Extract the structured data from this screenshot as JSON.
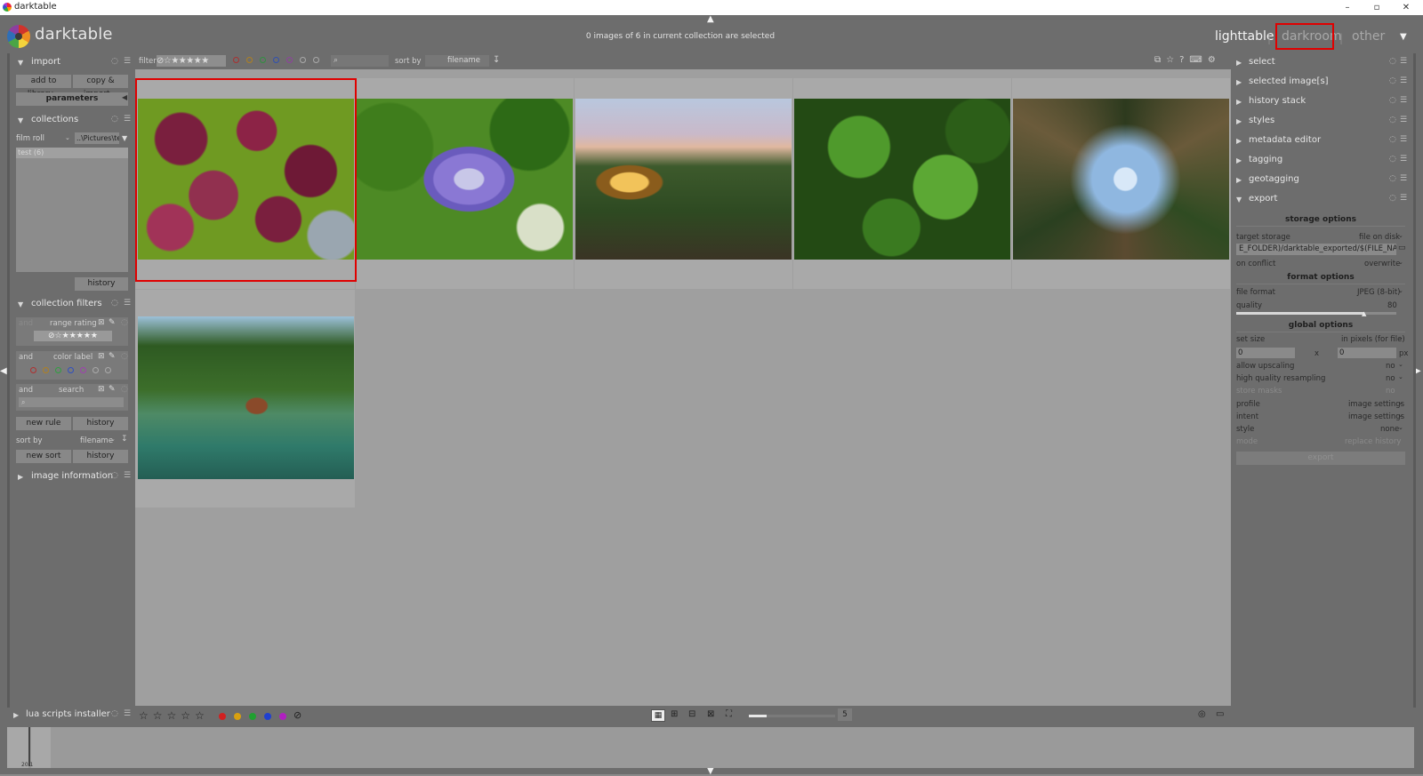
{
  "window": {
    "title": "darktable",
    "minimize": "–",
    "maximize": "▫",
    "close": "✕"
  },
  "header": {
    "app_name": "darktable",
    "selection_info": "0 images of 6 in current collection are selected",
    "views": {
      "lighttable": "lighttable",
      "darkroom": "darkroom",
      "other": "other"
    },
    "separator": "|"
  },
  "topbar": {
    "filter_label": "filter",
    "sort_by_label": "sort by",
    "sort_value": "filename",
    "search_icon": "⌕"
  },
  "left": {
    "import": {
      "title": "import",
      "add_to_library": "add to library...",
      "copy_import": "copy & import...",
      "parameters": "parameters"
    },
    "collections": {
      "title": "collections",
      "property": "film roll",
      "path": "..\\Pictures\\test",
      "items": [
        "test (6)"
      ],
      "history": "history"
    },
    "collection_filters": {
      "title": "collection filters",
      "rules": [
        {
          "op": "and",
          "name": "range rating"
        },
        {
          "op": "and",
          "name": "color label"
        },
        {
          "op": "and",
          "name": "search"
        }
      ],
      "new_rule": "new rule",
      "history": "history",
      "sort_by_label": "sort by",
      "sort_value": "filename",
      "new_sort": "new sort",
      "history2": "history"
    },
    "image_information": {
      "title": "image information"
    },
    "lua": {
      "title": "lua scripts installer"
    }
  },
  "right": {
    "modules": [
      "select",
      "selected image[s]",
      "history stack",
      "styles",
      "metadata editor",
      "tagging",
      "geotagging",
      "export"
    ],
    "storage_options_title": "storage options",
    "target_storage": {
      "label": "target storage",
      "value": "file on disk"
    },
    "path": "E_FOLDER)/darktable_exported/$(FILE_NAME)",
    "on_conflict": {
      "label": "on conflict",
      "value": "overwrite"
    },
    "format_options_title": "format options",
    "file_format": {
      "label": "file format",
      "value": "JPEG (8-bit)"
    },
    "quality": {
      "label": "quality",
      "value": "80",
      "level": 0.8
    },
    "global_options_title": "global options",
    "set_size": {
      "label": "set size",
      "value": "in pixels (for file)"
    },
    "width": "0",
    "x": "x",
    "height": "0",
    "unit": "px",
    "allow_upscaling": {
      "label": "allow upscaling",
      "value": "no"
    },
    "high_quality": {
      "label": "high quality resampling",
      "value": "no"
    },
    "store_masks": {
      "label": "store masks",
      "value": "no"
    },
    "profile": {
      "label": "profile",
      "value": "image settings"
    },
    "intent": {
      "label": "intent",
      "value": "image settings"
    },
    "style": {
      "label": "style",
      "value": "none"
    },
    "mode": {
      "label": "mode",
      "value": "replace history"
    },
    "export_button": "export"
  },
  "bottom": {
    "zoom_value": "5",
    "filmstrip_label": "20.1"
  },
  "colors": {
    "red": "#d02020",
    "yellow": "#d8a010",
    "green": "#20a030",
    "blue": "#2040d0",
    "purple": "#b020c0",
    "selection": "#e00000"
  }
}
